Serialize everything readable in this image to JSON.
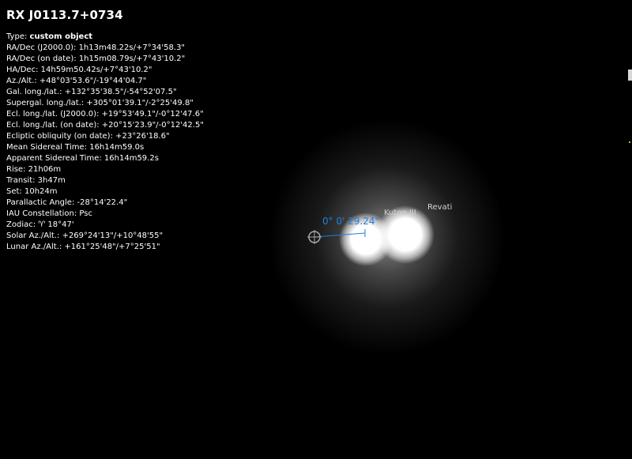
{
  "object": {
    "name": "RX J0113.7+0734",
    "type_label": "Type:",
    "type_value": "custom object",
    "rows": [
      "RA/Dec (J2000.0): 1h13m48.22s/+7°34'58.3\"",
      "RA/Dec (on date): 1h15m08.79s/+7°43'10.2\"",
      "HA/Dec: 14h59m50.42s/+7°43'10.2\"",
      "Az./Alt.: +48°03'53.6\"/-19°44'04.7\"",
      "Gal. long./lat.: +132°35'38.5\"/-54°52'07.5\"",
      "Supergal. long./lat.: +305°01'39.1\"/-2°25'49.8\"",
      "Ecl. long./lat. (J2000.0): +19°53'49.1\"/-0°12'47.6\"",
      "Ecl. long./lat. (on date): +20°15'23.9\"/-0°12'42.5\"",
      "Ecliptic obliquity (on date): +23°26'18.6\"",
      "Mean Sidereal Time: 16h14m59.0s",
      "Apparent Sidereal Time: 16h14m59.2s",
      "Rise: 21h06m",
      "Transit: 3h47m",
      "Set: 10h24m",
      "Parallactic Angle: -28°14'22.4\"",
      "IAU Constellation: Psc",
      "Zodiac: ♈ 18°47'",
      "Solar Az./Alt.: +269°24'13\"/+10°48'55\"",
      "Lunar Az./Alt.: +161°25'48\"/+7°25'51\""
    ]
  },
  "sky": {
    "measure_label": "0° 0' 29.24\"",
    "star_labels": [
      "Kuton III",
      "Revati"
    ]
  },
  "colors": {
    "background": "#000000",
    "text": "#ffffff",
    "measure": "#1e7fe0",
    "star_label": "#d2d2d2",
    "reticle": "#a8a8a8"
  }
}
